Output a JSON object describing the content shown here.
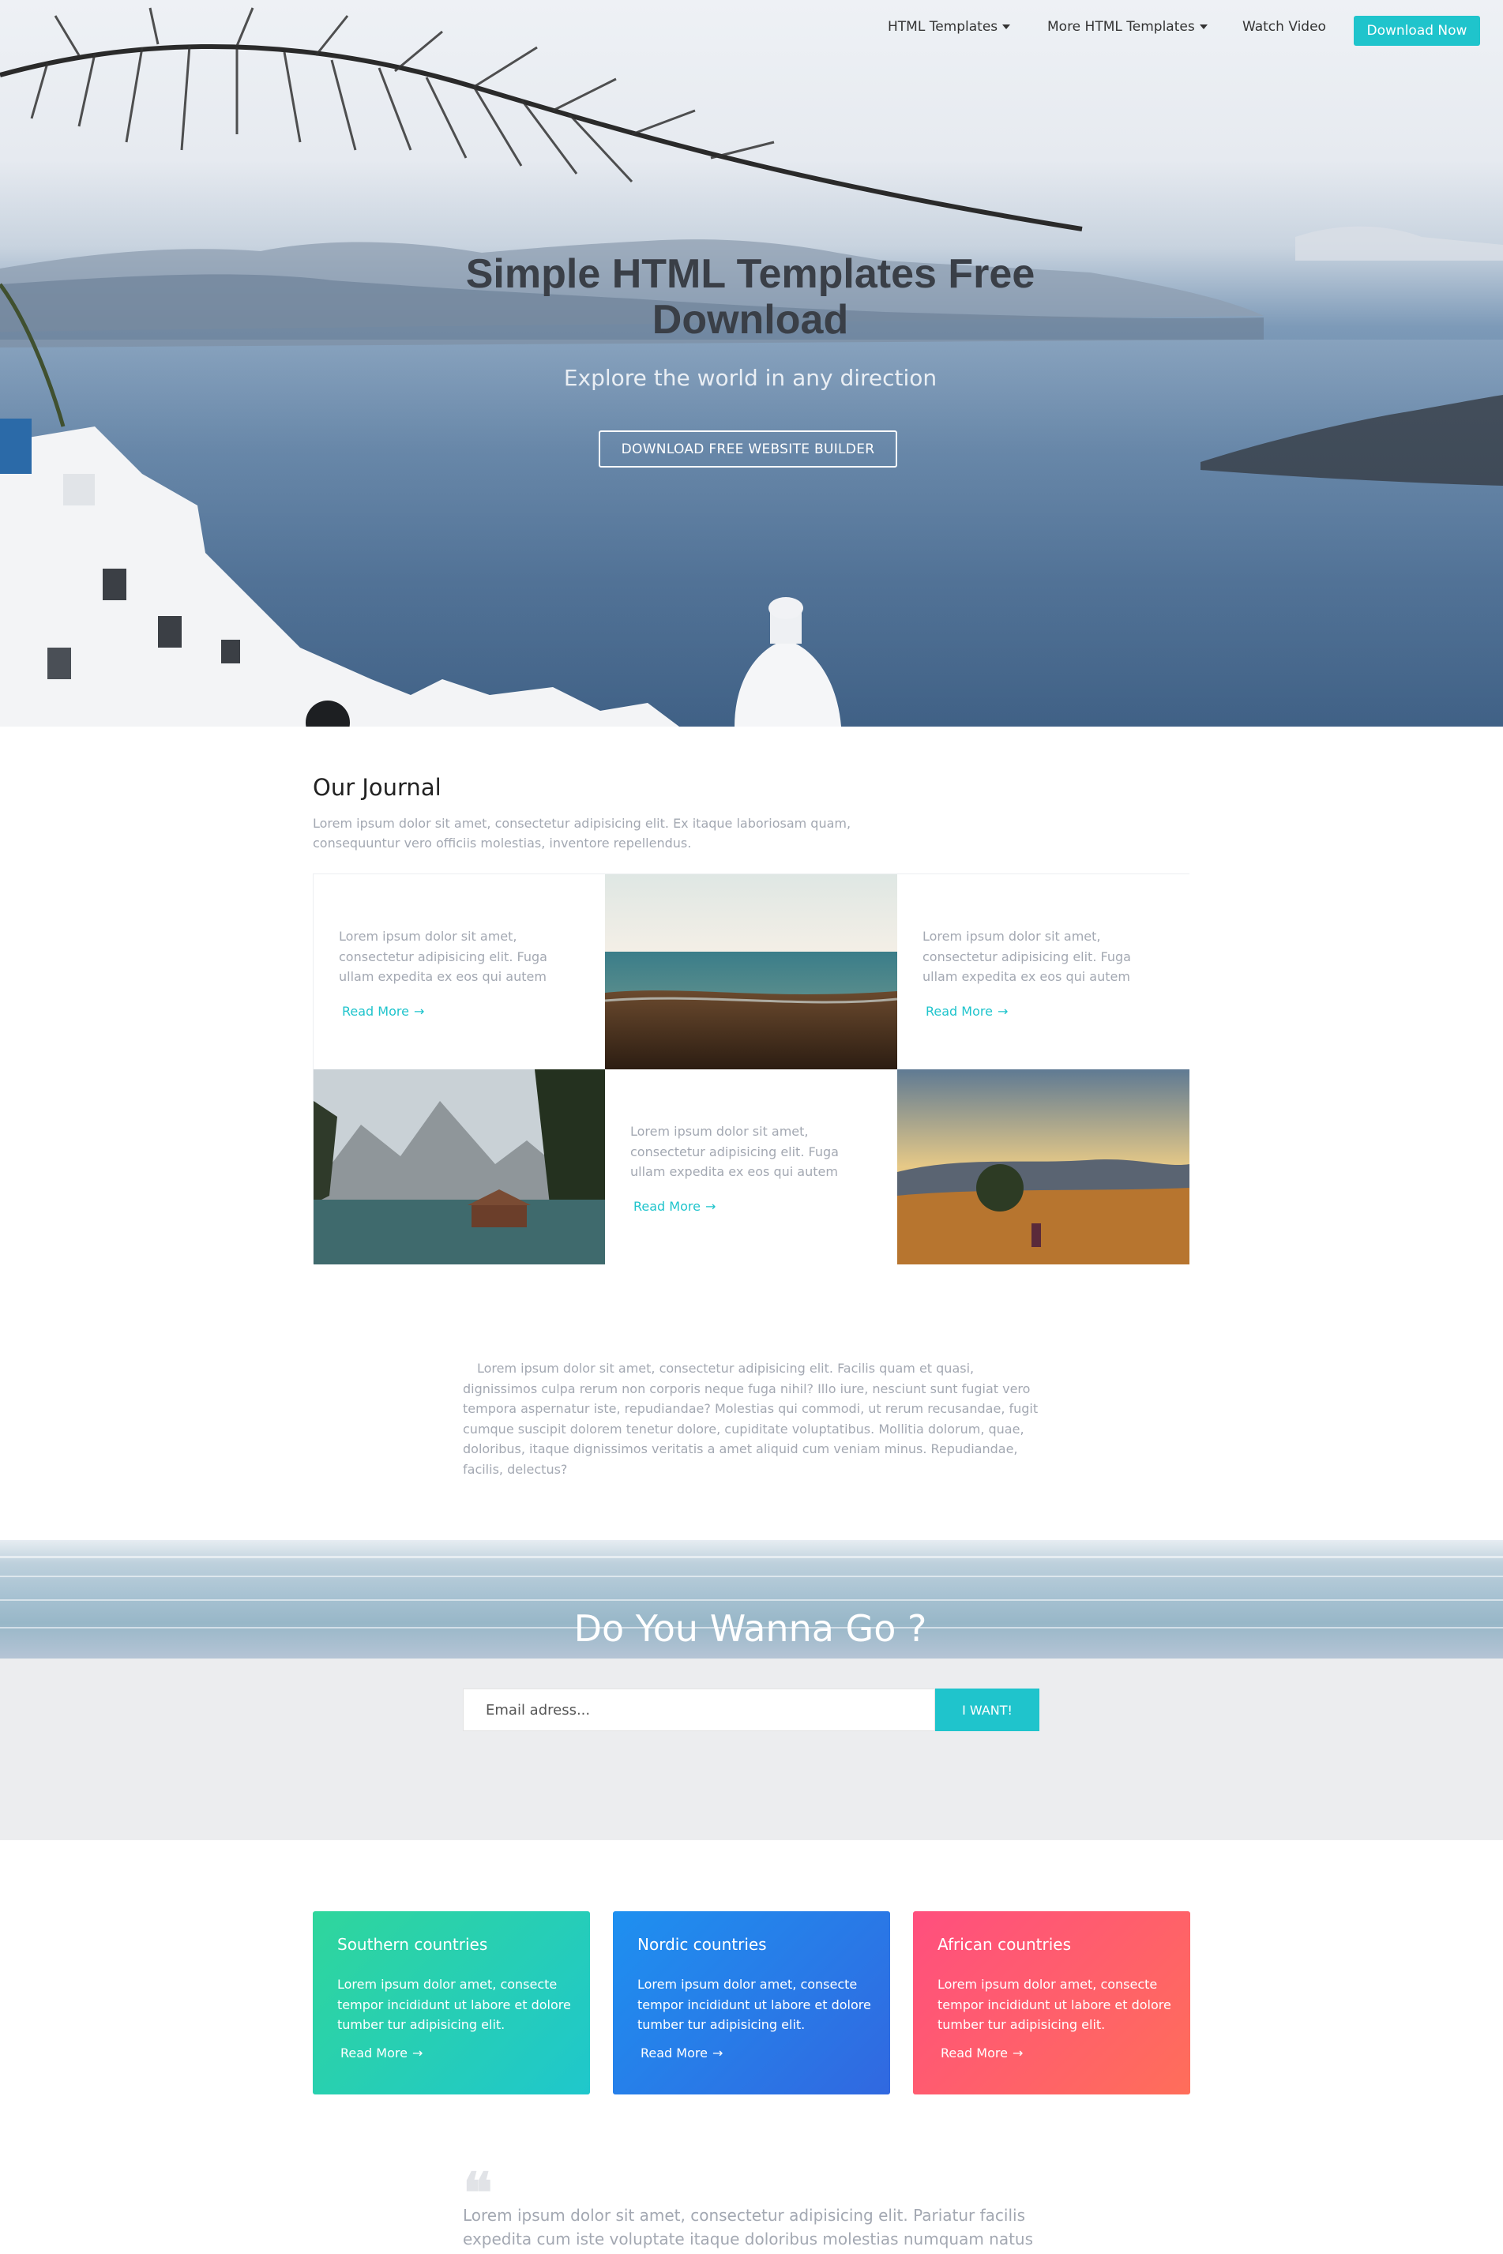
{
  "nav": {
    "items": [
      {
        "label": "HTML Templates",
        "dropdown": true
      },
      {
        "label": "More HTML Templates",
        "dropdown": true
      },
      {
        "label": "Watch Video",
        "dropdown": false
      }
    ],
    "cta": "Download Now"
  },
  "hero": {
    "title": "Simple HTML Templates Free Download",
    "subtitle": "Explore the world in any direction",
    "button": "DOWNLOAD FREE WEBSITE BUILDER"
  },
  "journal": {
    "title": "Our Journal",
    "intro": "Lorem ipsum dolor sit amet, consectetur adipisicing elit. Ex itaque laboriosam quam, consequuntur vero officiis molestias, inventore repellendus.",
    "cells": [
      {
        "type": "text",
        "text": "Lorem ipsum dolor sit amet, consectetur adipisicing elit. Fuga ullam expedita ex eos qui autem",
        "link": "Read More"
      },
      {
        "type": "image",
        "image": "beach-photo"
      },
      {
        "type": "text",
        "text": "Lorem ipsum dolor sit amet, consectetur adipisicing elit. Fuga ullam expedita ex eos qui autem",
        "link": "Read More"
      },
      {
        "type": "image",
        "image": "mountain-lake-photo"
      },
      {
        "type": "text",
        "text": "Lorem ipsum dolor sit amet, consectetur adipisicing elit. Fuga ullam expedita ex eos qui autem",
        "link": "Read More"
      },
      {
        "type": "image",
        "image": "sunset-field-photo"
      }
    ]
  },
  "middle_paragraph": "Lorem ipsum dolor sit amet, consectetur adipisicing elit. Facilis quam et quasi, dignissimos culpa rerum non corporis neque fuga nihil? Illo iure, nesciunt sunt fugiat vero tempora aspernatur iste, repudiandae? Molestias qui commodi, ut rerum recusandae, fugit cumque suscipit dolorem tenetur dolore, cupiditate voluptatibus. Mollitia dolorum, quae, doloribus, itaque dignissimos veritatis a amet aliquid cum veniam minus. Repudiandae, facilis, delectus?",
  "subscribe": {
    "title": "Do You Wanna Go ?",
    "placeholder": "Email adress...",
    "button": "I WANT!"
  },
  "cards": [
    {
      "title": "Southern countries",
      "text": "Lorem ipsum dolor amet, consecte tempor incididunt ut labore et dolore tumber tur adipisicing elit.",
      "link": "Read More",
      "gradient": [
        "#2fd69c",
        "#1fc7cc"
      ]
    },
    {
      "title": "Nordic countries",
      "text": "Lorem ipsum dolor amet, consecte tempor incididunt ut labore et dolore tumber tur adipisicing elit.",
      "link": "Read More",
      "gradient": [
        "#1e90f0",
        "#3168e0"
      ]
    },
    {
      "title": "African countries",
      "text": "Lorem ipsum dolor amet, consecte tempor incididunt ut labore et dolore tumber tur adipisicing elit.",
      "link": "Read More",
      "gradient": [
        "#ff4f7e",
        "#ff6e5a"
      ]
    }
  ],
  "quote": {
    "icon": "quote-icon",
    "text": "Lorem ipsum dolor sit amet, consectetur adipisicing elit. Pariatur facilis expedita cum iste voluptate itaque doloribus molestias numquam natus"
  },
  "colors": {
    "accent": "#1fc4cc",
    "muted_text": "#a3a8b2"
  }
}
